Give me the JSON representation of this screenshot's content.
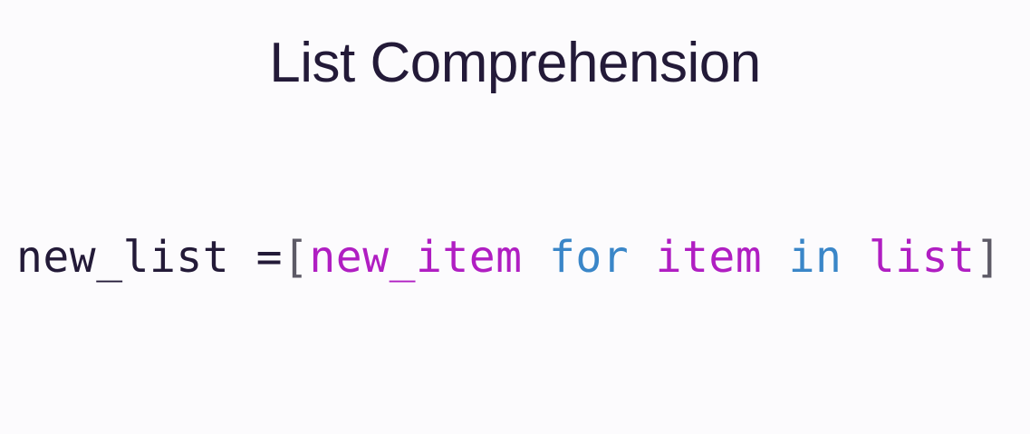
{
  "slide": {
    "title": "List Comprehension",
    "code": {
      "tokens": [
        {
          "id": "lhs",
          "text": "new_list =",
          "color": "#231a38"
        },
        {
          "id": "open_bracket",
          "text": "[",
          "color": "#5d5a66"
        },
        {
          "id": "expression",
          "text": "new_item",
          "color": "#b01ec2"
        },
        {
          "id": "sp1",
          "text": " ",
          "color": "#231a38"
        },
        {
          "id": "kw_for",
          "text": "for",
          "color": "#3a86c8"
        },
        {
          "id": "sp2",
          "text": " ",
          "color": "#231a38"
        },
        {
          "id": "target",
          "text": "item",
          "color": "#b01ec2"
        },
        {
          "id": "sp3",
          "text": " ",
          "color": "#231a38"
        },
        {
          "id": "kw_in",
          "text": "in",
          "color": "#3a86c8"
        },
        {
          "id": "sp4",
          "text": " ",
          "color": "#231a38"
        },
        {
          "id": "iterable",
          "text": "list",
          "color": "#b01ec2"
        },
        {
          "id": "close_bracket",
          "text": "]",
          "color": "#5d5a66"
        }
      ]
    }
  }
}
